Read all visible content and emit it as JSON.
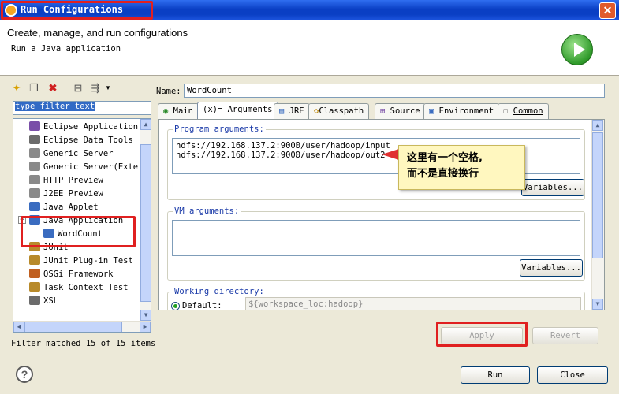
{
  "window": {
    "title": "Run Configurations",
    "close_label": "✕"
  },
  "header": {
    "title": "Create, manage, and run configurations",
    "subtitle": "Run a Java application"
  },
  "left": {
    "filter_text": "type filter text",
    "tree": [
      {
        "label": "Eclipse Application",
        "icon": "eclipse-icon",
        "color": "#7a4fa8"
      },
      {
        "label": "Eclipse Data Tools",
        "icon": "database-icon",
        "color": "#6b6b6b"
      },
      {
        "label": "Generic Server",
        "icon": "document-icon",
        "color": "#8a8a8a"
      },
      {
        "label": "Generic Server(Exte",
        "icon": "document-icon",
        "color": "#8a8a8a"
      },
      {
        "label": "HTTP Preview",
        "icon": "document-icon",
        "color": "#8a8a8a"
      },
      {
        "label": "J2EE Preview",
        "icon": "document-icon",
        "color": "#8a8a8a"
      },
      {
        "label": "Java Applet",
        "icon": "applet-icon",
        "color": "#3a6cc0"
      },
      {
        "label": "Java Application",
        "icon": "java-app-icon",
        "color": "#3a6cc0"
      },
      {
        "label": "WordCount",
        "icon": "java-app-icon",
        "color": "#3a6cc0"
      },
      {
        "label": "JUnit",
        "icon": "junit-icon",
        "color": "#b88a2a"
      },
      {
        "label": "JUnit Plug-in Test",
        "icon": "junit-icon",
        "color": "#b88a2a"
      },
      {
        "label": "OSGi Framework",
        "icon": "osgi-icon",
        "color": "#c06020"
      },
      {
        "label": "Task Context Test",
        "icon": "junit-icon",
        "color": "#b88a2a"
      },
      {
        "label": "XSL",
        "icon": "xsl-icon",
        "color": "#6b6b6b"
      }
    ],
    "status": "Filter matched 15 of 15 items"
  },
  "right": {
    "name_label": "Name:",
    "name_value": "WordCount",
    "tabs": [
      "Main",
      "(x)= Arguments",
      "JRE",
      "Classpath",
      "Source",
      "Environment",
      "Common"
    ],
    "program_args_label": "Program arguments:",
    "program_args_line1": "hdfs://192.168.137.2:9000/user/hadoop/input",
    "program_args_line2": "hdfs://192.168.137.2:9000/user/hadoop/out2",
    "variables_label": "Variables...",
    "vm_args_label": "VM arguments:",
    "working_dir_label": "Working directory:",
    "default_label": "Default:",
    "default_value": "${workspace_loc:hadoop}",
    "apply_label": "Apply",
    "revert_label": "Revert"
  },
  "callout": {
    "line1": "这里有一个空格,",
    "line2": "而不是直接换行"
  },
  "footer": {
    "run_label": "Run",
    "close_label": "Close",
    "help_label": "?"
  }
}
